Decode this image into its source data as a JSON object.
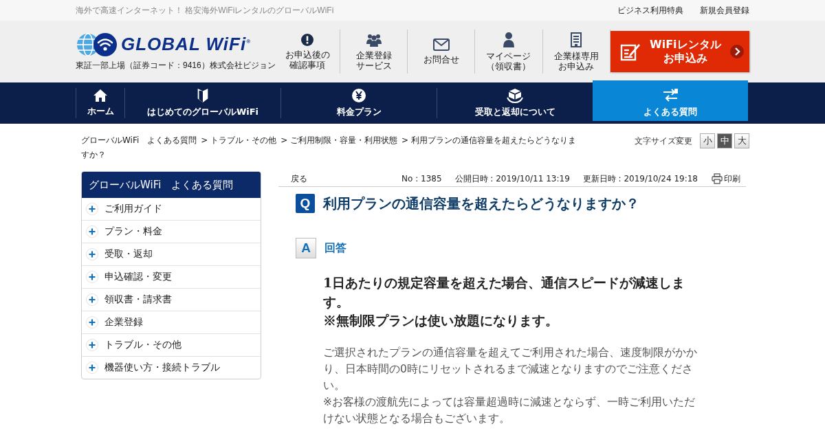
{
  "top_bar": {
    "tagline": "海外で高速インターネット！ 格安海外WiFiレンタルのグローバルWiFi",
    "links": [
      "ビジネス利用特典",
      "新規会員登録"
    ]
  },
  "header": {
    "logo": {
      "wordmark": "GLOBAL WiFi",
      "registered": "®",
      "company": "東証一部上場（証券コード：9416）株式会社ビジョン"
    },
    "links": [
      {
        "lines": [
          "お申込後の",
          "確認事項"
        ]
      },
      {
        "lines": [
          "企業登録",
          "サービス"
        ]
      },
      {
        "lines": [
          "お問合せ"
        ]
      },
      {
        "lines": [
          "マイページ",
          "（領収書）"
        ]
      },
      {
        "lines": [
          "企業様専用",
          "お申込み"
        ]
      }
    ],
    "cta": {
      "lines": [
        "WiFiレンタル",
        "お申込み"
      ]
    }
  },
  "nav": [
    {
      "label": "ホーム",
      "selected": false
    },
    {
      "label": "はじめてのグローバルWiFi",
      "selected": false
    },
    {
      "label": "料金プラン",
      "selected": false
    },
    {
      "label": "受取と返却について",
      "selected": false
    },
    {
      "label": "よくある質問",
      "selected": true
    }
  ],
  "breadcrumb": [
    "グローバルWiFi　よくある質問",
    "> トラブル・その他",
    "> ご利用制限・容量・利用状態",
    "> 利用プランの通信容量を超えたらどうなりますか？"
  ],
  "font_size": {
    "label": "文字サイズ変更",
    "options": [
      {
        "label": "小",
        "selected": false
      },
      {
        "label": "中",
        "selected": true
      },
      {
        "label": "大",
        "selected": false
      }
    ]
  },
  "sidebar": {
    "title": "グローバルWiFi　よくある質問",
    "items": [
      "ご利用ガイド",
      "プラン・料金",
      "受取・返却",
      "申込確認・変更",
      "領収書・請求書",
      "企業登録",
      "トラブル・その他",
      "機器使い方・接続トラブル"
    ]
  },
  "article": {
    "back": "戻る",
    "number": "No : 1385",
    "published": "公開日時 : 2019/10/11 13:19",
    "updated": "更新日時 : 2019/10/24 19:18",
    "print": "印刷",
    "q_mark": "Q",
    "question": "利用プランの通信容量を超えたらどうなりますか？",
    "a_mark": "A",
    "answer_heading": "回答",
    "lead": [
      "1日あたりの規定容量を超えた場合、通信スピードが減速します。",
      "※無制限プランは使い放題になります。"
    ],
    "body": [
      "ご選択されたプランの通信容量を超えてご利用された場合、速度制限がかかり、日本時間の0時にリセットされるまで減速となりますのでご注意ください。",
      "※お客様の渡航先によっては容量超過時に減速とならず、一時ご利用いただけない状態となる場合もございます。"
    ]
  }
}
